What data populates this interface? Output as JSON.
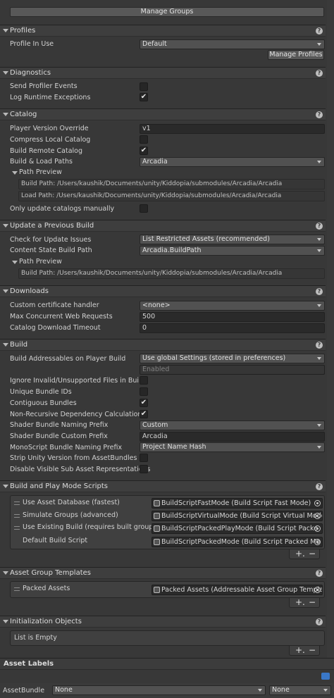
{
  "top_button": "Manage Groups",
  "profiles": {
    "title": "Profiles",
    "profile_in_use_label": "Profile In Use",
    "profile_in_use_value": "Default",
    "manage_profiles_button": "Manage Profiles"
  },
  "diagnostics": {
    "title": "Diagnostics",
    "send_profiler_label": "Send Profiler Events",
    "send_profiler_checked": false,
    "log_runtime_label": "Log Runtime Exceptions",
    "log_runtime_checked": true
  },
  "catalog": {
    "title": "Catalog",
    "player_version_label": "Player Version Override",
    "player_version_value": "v1",
    "compress_label": "Compress Local Catalog",
    "build_remote_label": "Build Remote Catalog",
    "build_load_paths_label": "Build & Load Paths",
    "build_load_paths_value": "Arcadia",
    "path_preview_label": "Path Preview",
    "build_path": "Build Path: /Users/kaushik/Documents/unity/Kiddopia/submodules/Arcadia/Arcadia",
    "load_path": "Load Path: /Users/kaushik/Documents/unity/Kiddopia/submodules/Arcadia/Arcadia",
    "only_update_label": "Only update catalogs manually"
  },
  "update_previous": {
    "title": "Update a Previous Build",
    "check_issues_label": "Check for Update Issues",
    "check_issues_value": "List Restricted Assets (recommended)",
    "content_state_label": "Content State Build Path",
    "content_state_value": "Arcadia.BuildPath",
    "path_preview_label": "Path Preview",
    "build_path": "Build Path: /Users/kaushik/Documents/unity/Kiddopia/submodules/Arcadia/Arcadia"
  },
  "downloads": {
    "title": "Downloads",
    "cert_handler_label": "Custom certificate handler",
    "cert_handler_value": "<none>",
    "max_requests_label": "Max Concurrent Web Requests",
    "max_requests_value": "500",
    "timeout_label": "Catalog Download Timeout",
    "timeout_value": "0"
  },
  "build": {
    "title": "Build",
    "build_on_player_label": "Build Addressables on Player Build",
    "build_on_player_value": "Use global Settings (stored in preferences)",
    "enabled_text": "Enabled",
    "ignore_invalid_label": "Ignore Invalid/Unsupported Files in Build",
    "unique_ids_label": "Unique Bundle IDs",
    "contiguous_label": "Contiguous Bundles",
    "non_recursive_label": "Non-Recursive Dependency Calculation",
    "shader_prefix_label": "Shader Bundle Naming Prefix",
    "shader_prefix_value": "Custom",
    "shader_custom_label": "Shader Bundle Custom Prefix",
    "shader_custom_value": "Arcadia",
    "monoscript_label": "MonoScript Bundle Naming Prefix",
    "monoscript_value": "Project Name Hash",
    "strip_unity_label": "Strip Unity Version from AssetBundles",
    "disable_visible_label": "Disable Visible Sub Asset Representations"
  },
  "build_play_scripts": {
    "title": "Build and Play Mode Scripts",
    "items": [
      {
        "label": "Use Asset Database (fastest)",
        "object": "BuildScriptFastMode (Build Script Fast Mode)"
      },
      {
        "label": "Simulate Groups (advanced)",
        "object": "BuildScriptVirtualMode (Build Script Virtual Mode"
      },
      {
        "label": "Use Existing Build (requires built groups)",
        "object": "BuildScriptPackedPlayMode (Build Script Packe"
      },
      {
        "label": "Default Build Script",
        "object": "BuildScriptPackedMode (Build Script Packed Mo"
      }
    ]
  },
  "asset_group_templates": {
    "title": "Asset Group Templates",
    "items": [
      {
        "label": "Packed Assets",
        "object": "Packed Assets (Addressable Asset Group Templa"
      }
    ]
  },
  "initialization_objects": {
    "title": "Initialization Objects",
    "empty_text": "List is Empty"
  },
  "asset_labels": {
    "title": "Asset Labels",
    "assetbundle_label": "AssetBundle",
    "assetbundle_value": "None",
    "variant_value": "None"
  },
  "help_glyph": "?",
  "check_glyph": "✔",
  "plus_glyph": "+.",
  "minus_glyph": "−"
}
